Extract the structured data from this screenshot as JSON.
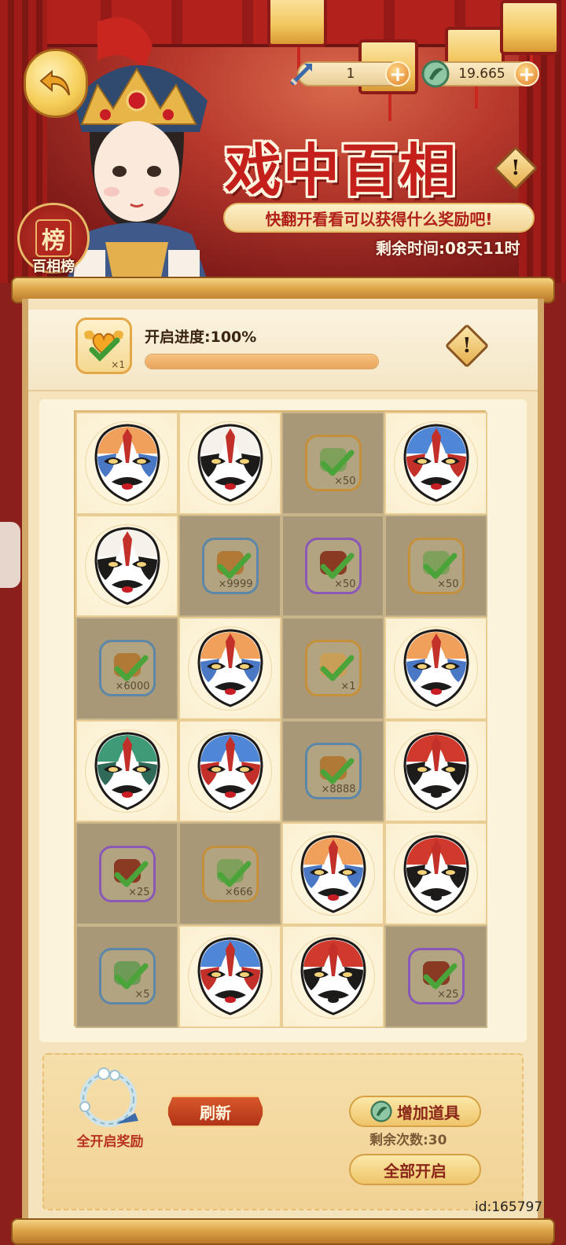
{
  "header": {
    "title": "戏中百相",
    "subtitle": "快翻开看看可以获得什么奖励吧!",
    "timer": "剩余时间:08天11时",
    "rank_badge_char": "榜",
    "rank_badge_label": "百相榜"
  },
  "currencies": [
    {
      "icon": "arrow-token-icon",
      "value": "1"
    },
    {
      "icon": "jade-coin-icon",
      "value": "19.665"
    }
  ],
  "progress": {
    "reward_count": "×1",
    "label": "开启进度:100%",
    "percent": 100
  },
  "grid": {
    "tiles": [
      {
        "type": "mask",
        "palette": "orange-blue"
      },
      {
        "type": "mask",
        "palette": "white-black"
      },
      {
        "type": "item",
        "item": "leaf",
        "frame": "gold",
        "qty": "×50"
      },
      {
        "type": "mask",
        "palette": "blue-red"
      },
      {
        "type": "mask",
        "palette": "white-black"
      },
      {
        "type": "item",
        "item": "coin",
        "frame": "blue",
        "qty": "×9999"
      },
      {
        "type": "item",
        "item": "chest",
        "frame": "purple",
        "qty": "×50"
      },
      {
        "type": "item",
        "item": "leaf",
        "frame": "gold",
        "qty": "×50"
      },
      {
        "type": "item",
        "item": "coin",
        "frame": "blue",
        "qty": "×6000"
      },
      {
        "type": "mask",
        "palette": "orange-blue"
      },
      {
        "type": "item",
        "item": "scroll",
        "frame": "gold",
        "qty": "×1"
      },
      {
        "type": "mask",
        "palette": "orange-blue"
      },
      {
        "type": "mask",
        "palette": "green"
      },
      {
        "type": "mask",
        "palette": "blue-red"
      },
      {
        "type": "item",
        "item": "coin",
        "frame": "blue",
        "qty": "×8888"
      },
      {
        "type": "mask",
        "palette": "red"
      },
      {
        "type": "item",
        "item": "chest",
        "frame": "purple",
        "qty": "×25"
      },
      {
        "type": "item",
        "item": "leaf",
        "frame": "gold",
        "qty": "×666"
      },
      {
        "type": "mask",
        "palette": "orange-blue"
      },
      {
        "type": "mask",
        "palette": "red"
      },
      {
        "type": "item",
        "item": "feather",
        "frame": "blue",
        "qty": "×5"
      },
      {
        "type": "mask",
        "palette": "blue-red"
      },
      {
        "type": "mask",
        "palette": "red"
      },
      {
        "type": "item",
        "item": "chest",
        "frame": "purple",
        "qty": "×25"
      }
    ]
  },
  "bottom": {
    "wreath_label": "全开启奖励",
    "refresh_label": "刷新",
    "add_item_label": "增加道具",
    "remaining_label": "剩余次数:30",
    "open_all_label": "全部开启"
  },
  "uid": "id:165797",
  "colors": {
    "title_red": "#c41f1a",
    "parchment": "#f4e3bd",
    "opened_tile": "#a89878",
    "check_green": "#4aa43a"
  }
}
